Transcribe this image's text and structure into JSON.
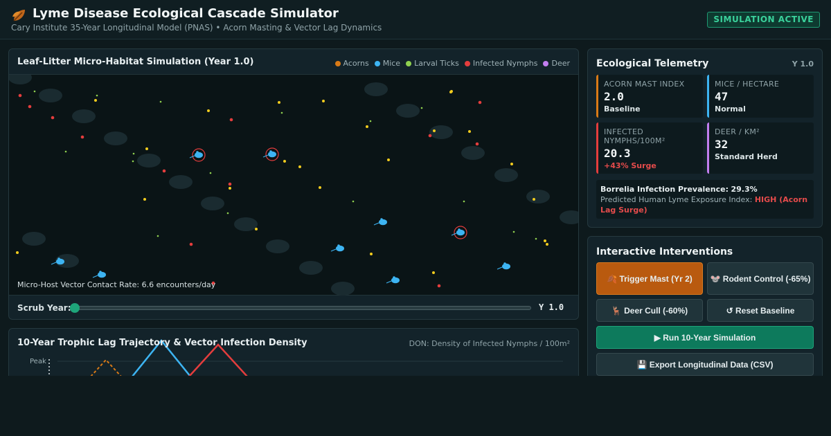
{
  "header": {
    "title": "Lyme Disease Ecological Cascade Simulator",
    "subtitle": "Cary Institute 35-Year Longitudinal Model (PNAS) • Acorn Masting & Vector Lag Dynamics",
    "status_badge": "SIMULATION ACTIVE",
    "logo_icon": "leaves-icon"
  },
  "colors": {
    "acorn": "#d97a16",
    "mouse": "#3db4f2",
    "tick": "#8fd14f",
    "nymph": "#e43d3d",
    "deer": "#c27ef0",
    "accent": "#1ea57a",
    "mast_button": "#b95a0f"
  },
  "simulation": {
    "title": "Leaf-Litter Micro-Habitat Simulation (Year 1.0)",
    "legend": [
      {
        "label": "Acorns",
        "color": "#d97a16"
      },
      {
        "label": "Mice",
        "color": "#3db4f2"
      },
      {
        "label": "Larval Ticks",
        "color": "#8fd14f"
      },
      {
        "label": "Infected Nymphs",
        "color": "#e43d3d"
      },
      {
        "label": "Deer",
        "color": "#c27ef0"
      }
    ],
    "contact_rate": "Micro-Host Vector Contact Rate: 6.6 encounters/day",
    "scrub_label": "Scrub Year:",
    "scrub_value": "Y 1.0",
    "scrub_fraction": 0.0
  },
  "trajectory": {
    "title": "10-Year Trophic Lag Trajectory & Vector Infection Density",
    "note": "DON: Density of Infected Nymphs / 100m²",
    "peak_label": "Peak"
  },
  "telemetry": {
    "title": "Ecological Telemetry",
    "year": "Y 1.0",
    "metrics": [
      {
        "label": "ACORN MAST INDEX",
        "value": "2.0",
        "status": "Baseline",
        "color": "#d97a16"
      },
      {
        "label": "MICE / HECTARE",
        "value": "47",
        "status": "Normal",
        "color": "#3db4f2"
      },
      {
        "label": "INFECTED NYMPHS/100M²",
        "value": "20.3",
        "status": "+43% Surge",
        "color": "#e43d3d"
      },
      {
        "label": "DEER / KM²",
        "value": "32",
        "status": "Standard Herd",
        "color": "#c27ef0"
      }
    ],
    "prevalence_label": "Borrelia Infection Prevalence:",
    "prevalence_value": "29.3%",
    "exposure_label": "Predicted Human Lyme Exposure Index:",
    "exposure_value": "HIGH (Acorn Lag Surge)"
  },
  "interventions": {
    "title": "Interactive Interventions",
    "trigger_mast": "🍂 Trigger Mast (Yr 2)",
    "rodent_control": "🐭 Rodent Control (-65%)",
    "deer_cull": "🦌 Deer Cull (-60%)",
    "reset": "↺ Reset Baseline",
    "run": "▶ Run 10-Year Simulation",
    "export": "💾 Export Longitudinal Data (CSV)"
  }
}
